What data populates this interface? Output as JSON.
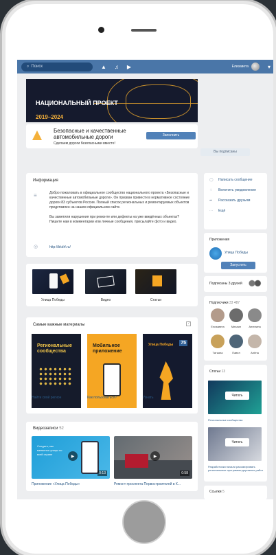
{
  "topbar": {
    "search_placeholder": "Поиск",
    "user_name": "Елизавета"
  },
  "group": {
    "title": "Безопасные и качественные автомобильные дороги",
    "subtitle": "Сделаем дороги безопасными вместе!",
    "cover_title": "НАЦИОНАЛЬНЫЙ ПРОЕКТ",
    "cover_years": "2019–2024",
    "primary_button": "Заполнить",
    "secondary_button": "Вы подписаны"
  },
  "info": {
    "title": "Информация",
    "text": "Добро пожаловать в официальное сообщество национального проекта «Безопасные и качественные автомобильные дороги». Он призван привести в нормативное состояние дороги 83 субъектов России. Полный список региональных и ремонтируемых объектов представлен на нашем официальном сайте.",
    "text2": "Вы заметили нарушения при ремонте или дефекты на уже введённых объектах? Пишите нам в комментарии или личные сообщения, присылайте фото и видео.",
    "link": "http://bkdrf.ru/"
  },
  "gallery": [
    {
      "label": "Улица Победы"
    },
    {
      "label": "Видео"
    },
    {
      "label": "Статьи"
    }
  ],
  "materials": {
    "title": "Самые важные материалы",
    "items": [
      {
        "card_text": "Региональные сообщества",
        "caption": "Найти свой регион",
        "bg": "#151b2b",
        "color": "#f4c84a"
      },
      {
        "card_text": "Мобильное приложение",
        "caption": "Как пользоваться?",
        "bg": "#f5a623",
        "color": "#1d1d1d"
      },
      {
        "card_text": "Улица Победы",
        "badge": "75",
        "caption": "Узнать",
        "bg": "#141a2e",
        "color": "#f5a623"
      }
    ]
  },
  "videos": {
    "title": "Видеозаписи",
    "count": "52",
    "items": [
      {
        "caption": "Приложение «Улица Победы»",
        "duration": "0:13",
        "overlay": "Следите, как меняются улицы по всей стране"
      },
      {
        "caption": "Ремонт проспекта Первостроителей в К...",
        "duration": "0:58",
        "overlay": ""
      }
    ]
  },
  "sidebar": {
    "write": "Написать сообщение",
    "notify": "Включить уведомления",
    "share": "Рассказать друзьям",
    "more": "Ещё",
    "apps_title": "Приложения",
    "app_name": "Улица Победы",
    "launch": "Запустить",
    "friends": "Подписаны 3 друзей",
    "followers_title": "Подписчики",
    "followers_count": "33 487",
    "members": [
      "Елизавета",
      "Михаил",
      "Ангелина",
      "Татьяна",
      "Павел",
      "Алёна"
    ],
    "articles_title": "Статьи",
    "articles_count": "13",
    "articles": [
      {
        "title": "Региональные сообщества",
        "read": "Читать"
      },
      {
        "title": "Разработчики начали рассматривать региональные программы дорожных работ",
        "read": "Читать"
      }
    ],
    "links_title": "Ссылки",
    "links_count": "5"
  }
}
